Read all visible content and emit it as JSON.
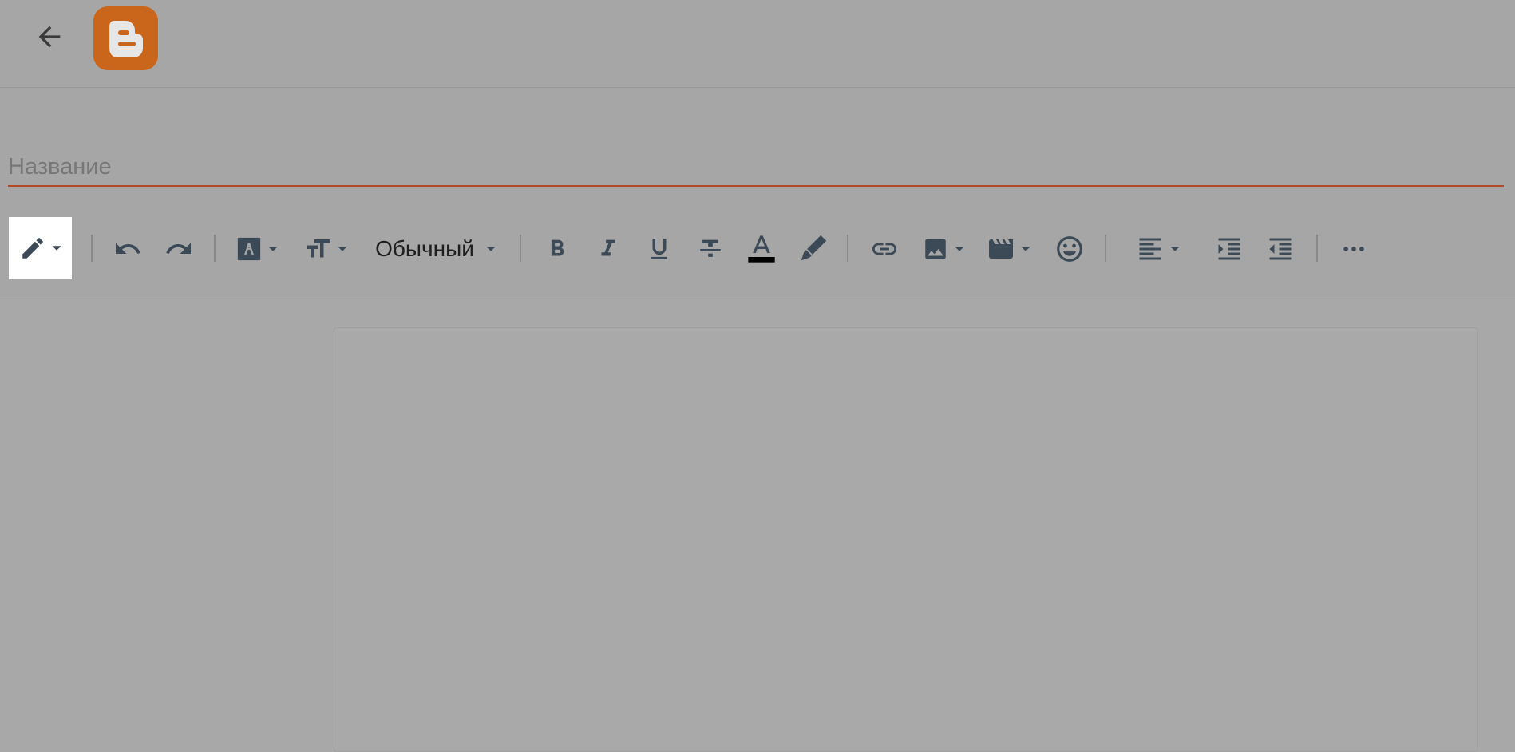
{
  "header": {
    "back_icon": "arrow-left-icon",
    "logo_icon": "blogger-logo-icon",
    "brand_color": "#c9661b"
  },
  "title": {
    "placeholder": "Название",
    "value": ""
  },
  "toolbar": {
    "paragraph_style": "Обычный",
    "text_color_bar": "#000000"
  }
}
